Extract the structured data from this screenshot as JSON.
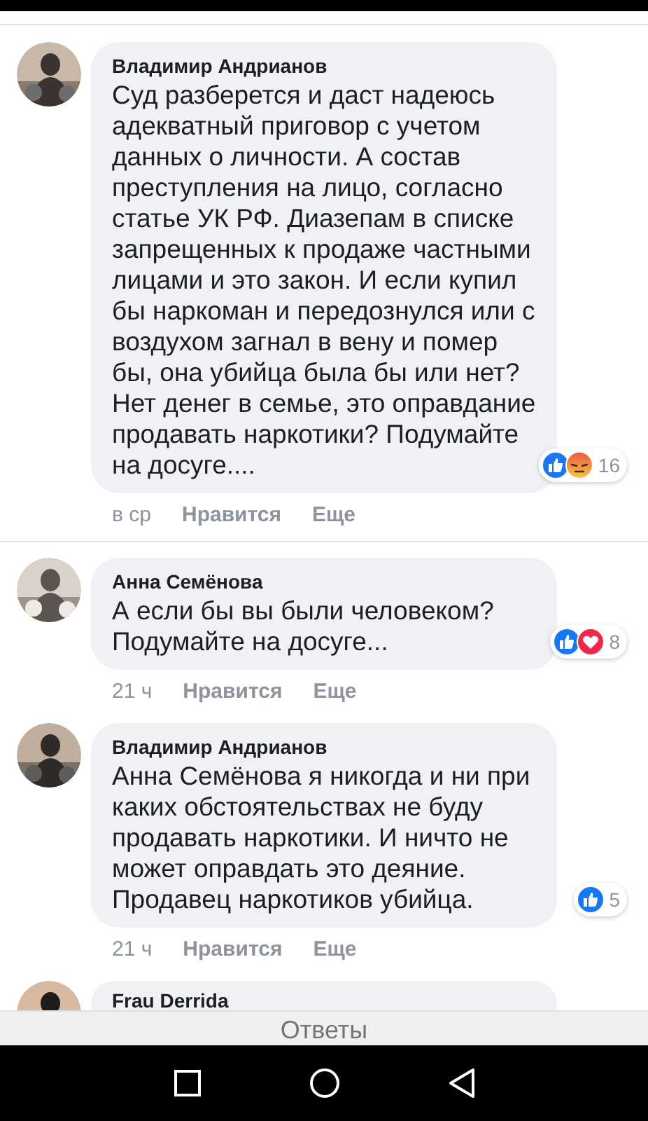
{
  "comments": [
    {
      "author": "Владимир Андрианов",
      "avatar": {
        "kind": "picture"
      },
      "text": "Суд разберется и даст надеюсь адекватный приговор с учетом данных о личности. А состав преступления на лицо, согласно статье УК РФ. Диазепам в списке запрещенных к продаже частными лицами и это закон. И если купил бы наркоман и передознулся или с воздухом загнал в вену и помер бы, она убийца была бы или нет? Нет денег в семье, это оправдание продавать наркотики? Подумайте на досуге....",
      "reactions": [
        {
          "kind": "like"
        },
        {
          "kind": "angry"
        }
      ],
      "reaction_count": "16",
      "time": "в ср",
      "actions": [
        "Нравится",
        "Еще"
      ]
    },
    {
      "author": "Анна Семёнова",
      "avatar": {
        "kind": "picture"
      },
      "text": "А если бы вы были человеком? Подумайте на досуге...",
      "reactions": [
        {
          "kind": "like"
        },
        {
          "kind": "love"
        }
      ],
      "reaction_count": "8",
      "time": "21 ч",
      "actions": [
        "Нравится",
        "Еще"
      ]
    },
    {
      "author": "Владимир Андрианов",
      "avatar": {
        "kind": "picture"
      },
      "text": "Анна Семёнова я никогда и ни при каких обстоятельствах не буду продавать наркотики. И ничто не может оправдать это деяние. Продавец наркотиков убийца.",
      "reactions": [
        {
          "kind": "like"
        }
      ],
      "reaction_count": "5",
      "time": "21 ч",
      "actions": [
        "Нравится",
        "Еще"
      ]
    },
    {
      "author": "Frau Derrida",
      "avatar": {
        "kind": "picture"
      }
    }
  ],
  "footer": {
    "label": "Ответы"
  }
}
